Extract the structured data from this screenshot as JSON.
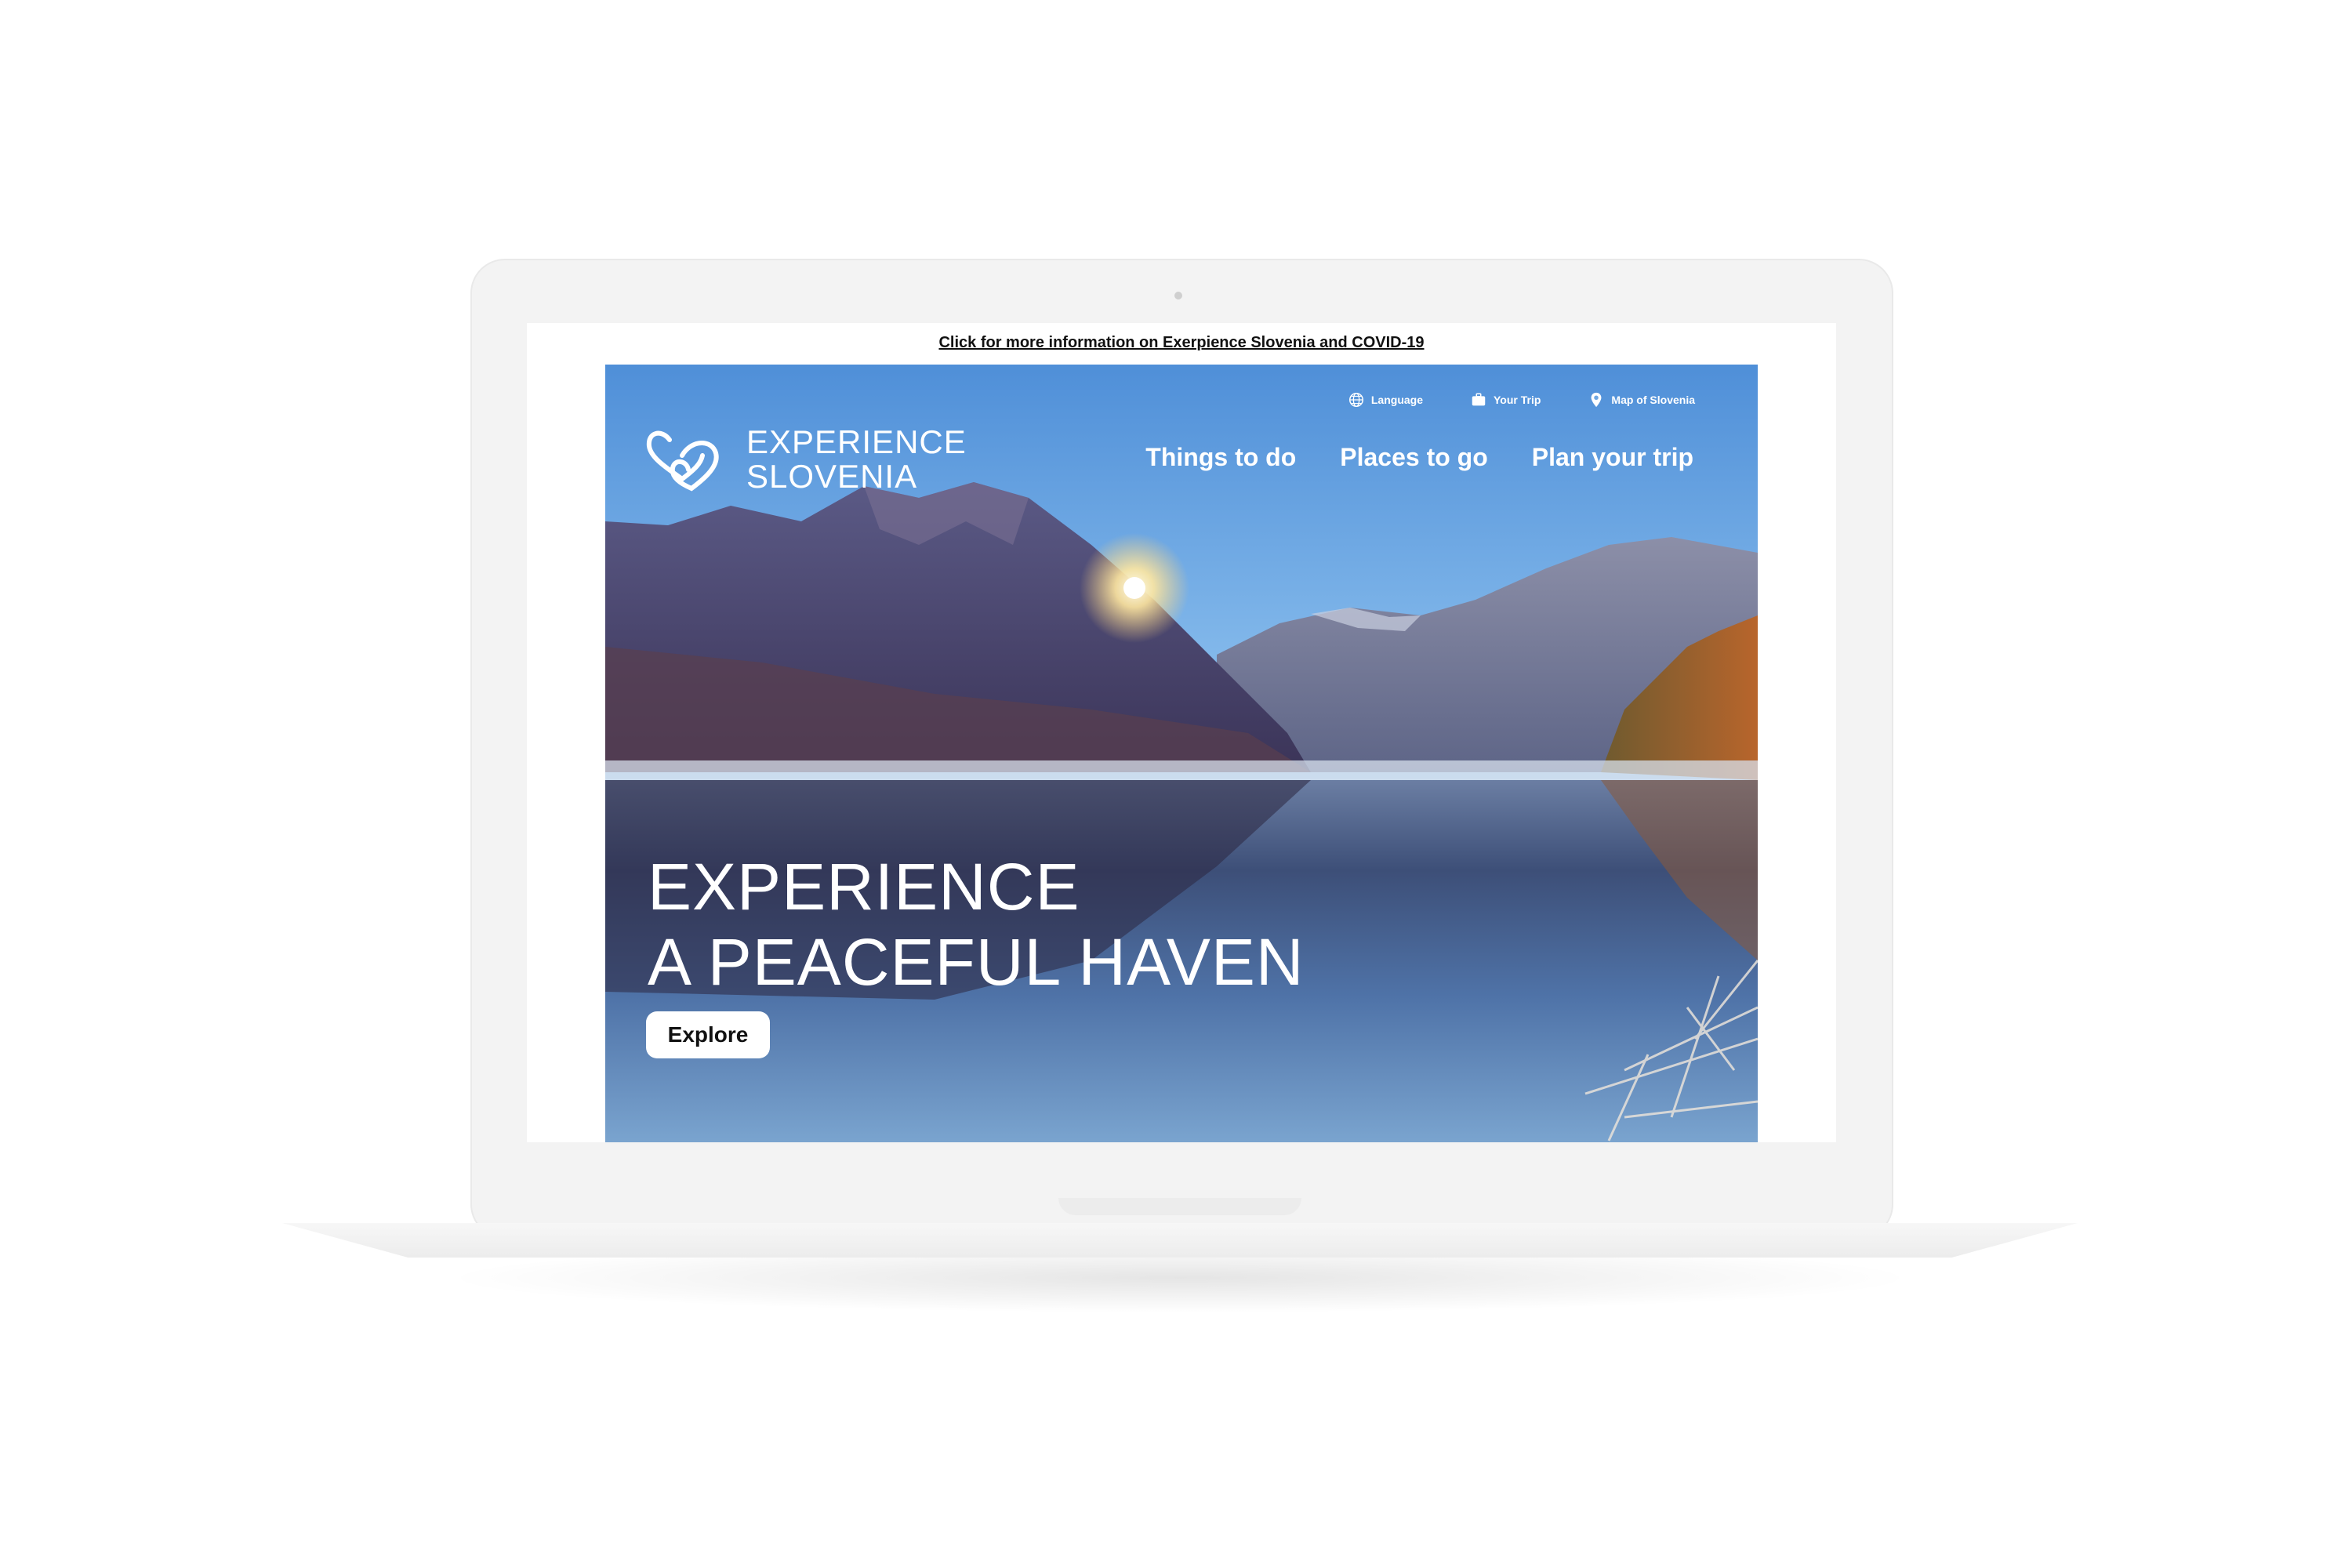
{
  "banner": {
    "covid_link": "Click for more information on Exerpience Slovenia and COVID-19"
  },
  "utility_nav": {
    "language": "Language",
    "your_trip": "Your Trip",
    "map": "Map of Slovenia"
  },
  "logo": {
    "line1": "EXPERIENCE",
    "line2": "SLOVENIA"
  },
  "main_nav": {
    "things_to_do": "Things to do",
    "places_to_go": "Places to go",
    "plan_trip": "Plan your trip"
  },
  "hero": {
    "headline_line1": "EXPERIENCE",
    "headline_line2": "A PEACEFUL HAVEN",
    "cta": "Explore"
  },
  "icons": {
    "language": "globe-icon",
    "your_trip": "suitcase-icon",
    "map": "map-pin-icon",
    "logo": "double-heart-logo"
  }
}
